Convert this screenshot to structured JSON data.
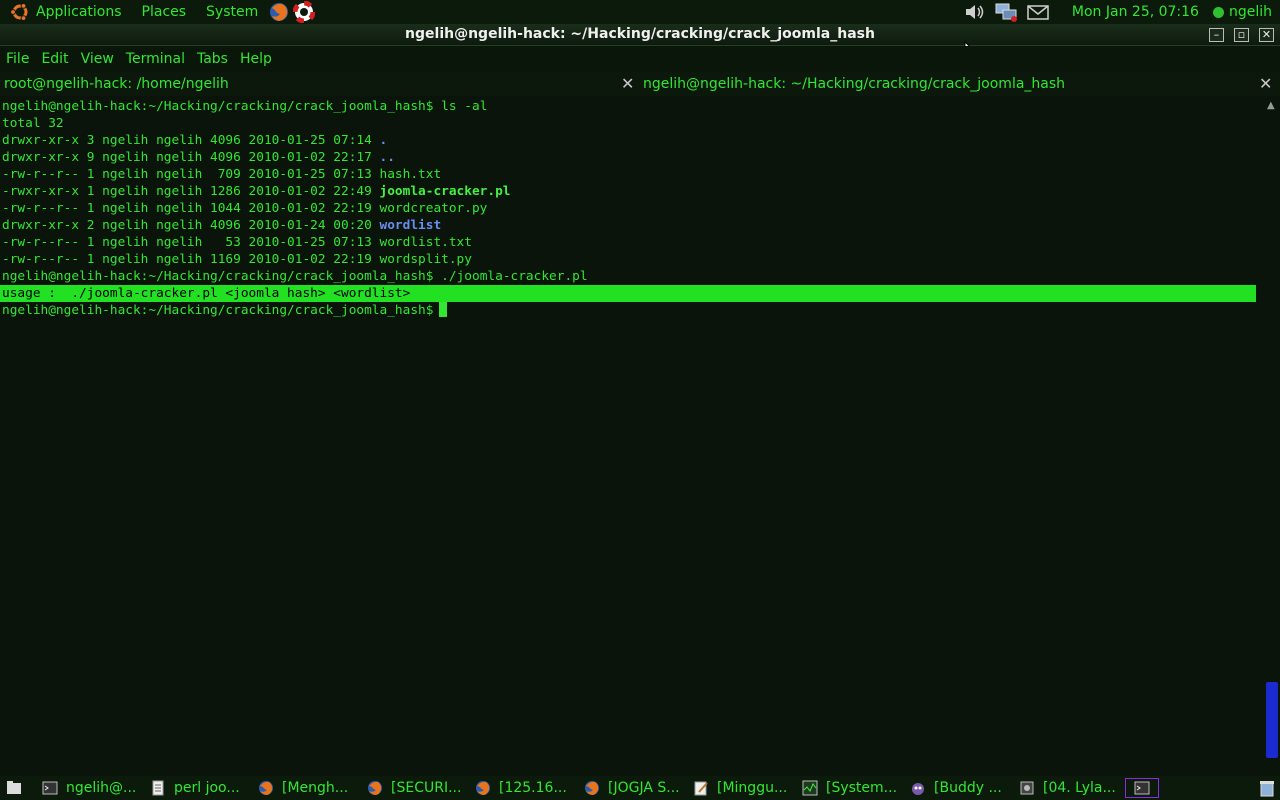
{
  "top_panel": {
    "menus": [
      "Applications",
      "Places",
      "System"
    ],
    "clock": "Mon Jan 25, 07:16",
    "user": "ngelih"
  },
  "window": {
    "title": "ngelih@ngelih-hack: ~/Hacking/cracking/crack_joomla_hash"
  },
  "menu_bar": [
    "File",
    "Edit",
    "View",
    "Terminal",
    "Tabs",
    "Help"
  ],
  "tabs": [
    {
      "label": "root@ngelih-hack: /home/ngelih"
    },
    {
      "label": "ngelih@ngelih-hack: ~/Hacking/cracking/crack_joomla_hash"
    }
  ],
  "terminal": {
    "prompt": "ngelih@ngelih-hack:~/Hacking/cracking/crack_joomla_hash$",
    "cmd1": "ls -al",
    "total": "total 32",
    "entries": [
      {
        "prefix": "drwxr-xr-x 3 ngelih ngelih 4096 2010-01-25 07:14 ",
        "name": "."
      },
      {
        "prefix": "drwxr-xr-x 9 ngelih ngelih 4096 2010-01-02 22:17 ",
        "name": ".."
      },
      {
        "prefix": "-rw-r--r-- 1 ngelih ngelih  709 2010-01-25 07:13 ",
        "name": "hash.txt"
      },
      {
        "prefix": "-rwxr-xr-x 1 ngelih ngelih 1286 2010-01-02 22:49 ",
        "name": "joomla-cracker.pl"
      },
      {
        "prefix": "-rw-r--r-- 1 ngelih ngelih 1044 2010-01-02 22:19 ",
        "name": "wordcreator.py"
      },
      {
        "prefix": "drwxr-xr-x 2 ngelih ngelih 4096 2010-01-24 00:20 ",
        "name": "wordlist"
      },
      {
        "prefix": "-rw-r--r-- 1 ngelih ngelih   53 2010-01-25 07:13 ",
        "name": "wordlist.txt"
      },
      {
        "prefix": "-rw-r--r-- 1 ngelih ngelih 1169 2010-01-02 22:19 ",
        "name": "wordsplit.py"
      }
    ],
    "cmd2": "./joomla-cracker.pl",
    "usage": "usage :  ./joomla-cracker.pl <joomla hash> <wordlist>"
  },
  "taskbar": [
    {
      "label": "ngelih@...",
      "icon": "terminal-icon"
    },
    {
      "label": "perl joo...",
      "icon": "document-icon"
    },
    {
      "label": "[Mengh...",
      "icon": "firefox-icon"
    },
    {
      "label": "[SECURI...",
      "icon": "firefox-icon"
    },
    {
      "label": "[125.16...",
      "icon": "firefox-icon"
    },
    {
      "label": "[JOGJA S...",
      "icon": "firefox-icon"
    },
    {
      "label": "[Minggu...",
      "icon": "editor-icon"
    },
    {
      "label": "[System...",
      "icon": "monitor-icon"
    },
    {
      "label": "[Buddy ...",
      "icon": "pidgin-icon"
    },
    {
      "label": "[04. Lyla...",
      "icon": "media-icon"
    }
  ],
  "colors": {
    "text_green": "#33e633",
    "highlight_green": "#22e022",
    "dir_blue": "#6c8df0",
    "background": "#0a140a"
  }
}
